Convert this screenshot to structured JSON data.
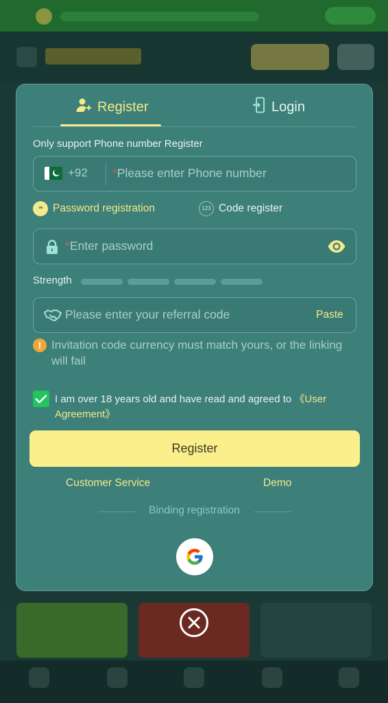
{
  "tabs": {
    "register_label": "Register",
    "login_label": "Login"
  },
  "form": {
    "subtitle": "Only support Phone number Register",
    "phone": {
      "country_code": "+92",
      "required_mark": "*",
      "placeholder": "Please enter Phone number"
    },
    "modes": {
      "password_label": "Password registration",
      "password_icon": "**",
      "code_label": "Code register",
      "code_icon": "123",
      "selected": "password"
    },
    "password": {
      "required_mark": "*",
      "placeholder": "Enter password"
    },
    "strength": {
      "label": "Strength",
      "level": 0,
      "segments": 4
    },
    "referral": {
      "placeholder": "Please enter your referral code",
      "paste_label": "Paste"
    },
    "warning": {
      "icon": "!",
      "text": "Invitation code currency must match yours, or the linking will fail"
    },
    "agreement": {
      "checked": true,
      "text": "I am over 18 years old and have read and agreed to",
      "link_text": "《User Agreement》"
    },
    "submit_label": "Register"
  },
  "footer_links": {
    "customer_service": "Customer Service",
    "demo": "Demo"
  },
  "binding": {
    "label": "Binding registration"
  },
  "icons": {
    "register_tab": "add-user-icon",
    "login_tab": "login-door-icon",
    "lock": "lock-icon",
    "eye": "eye-icon",
    "referral": "handshake-icon",
    "google": "google-icon",
    "close": "close-icon"
  },
  "colors": {
    "modal_bg": "#3d7f79",
    "accent": "#f4e98d",
    "button_bg": "#fbef8c",
    "check": "#22c55e",
    "warning": "#f0a73a"
  }
}
